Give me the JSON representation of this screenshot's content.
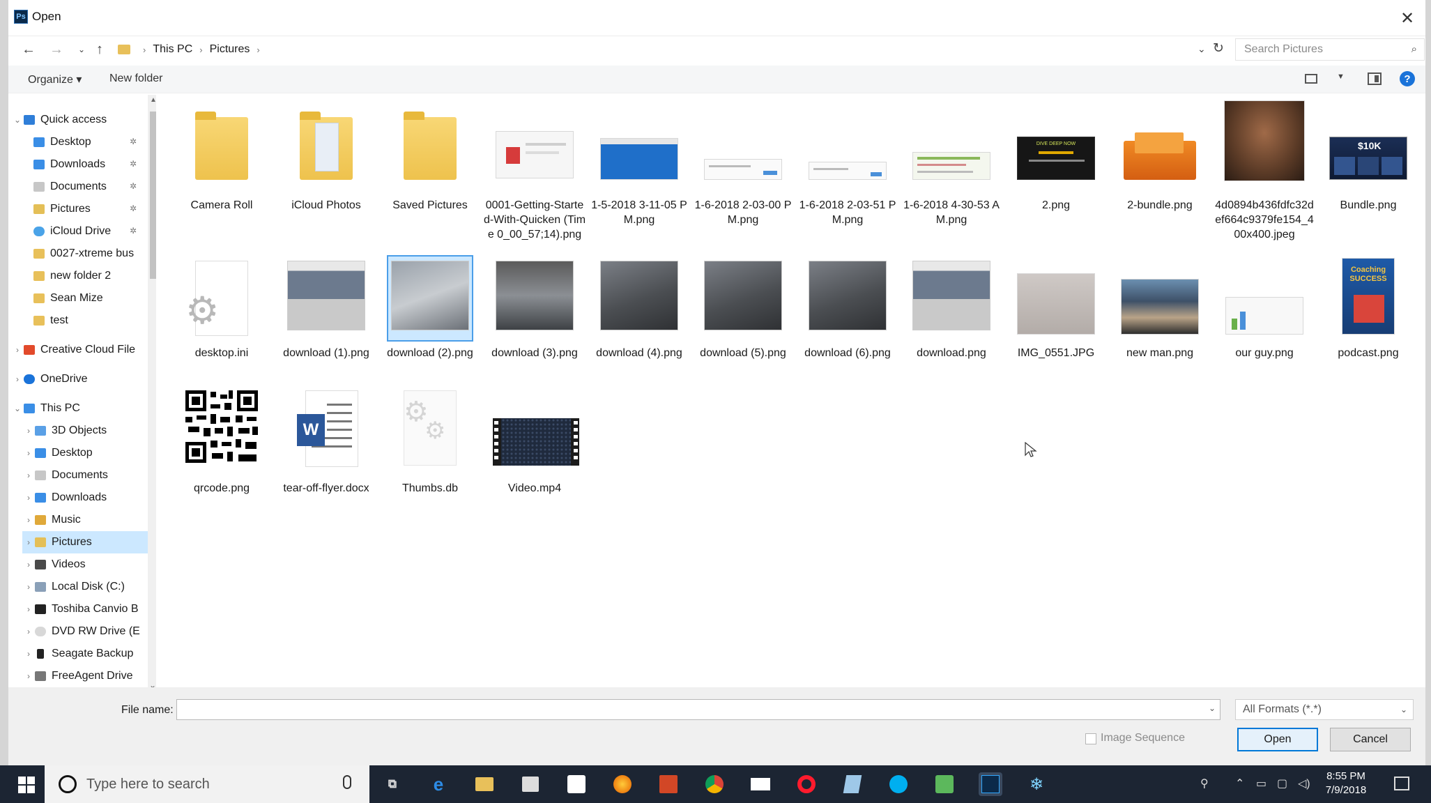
{
  "window": {
    "title": "Open",
    "app_icon_text": "Ps"
  },
  "address": {
    "crumbs": [
      "This PC",
      "Pictures"
    ],
    "search_placeholder": "Search Pictures"
  },
  "toolbar": {
    "organize": "Organize ▾",
    "new_folder": "New folder",
    "help": "?"
  },
  "nav": {
    "quick_access": "Quick access",
    "quick_items": [
      "Desktop",
      "Downloads",
      "Documents",
      "Pictures",
      "iCloud Drive",
      "0027-xtreme bus",
      "new folder 2",
      "Sean Mize",
      "test"
    ],
    "creative_cloud": "Creative Cloud File",
    "onedrive": "OneDrive",
    "this_pc": "This PC",
    "pc_items": [
      "3D Objects",
      "Desktop",
      "Documents",
      "Downloads",
      "Music",
      "Pictures",
      "Videos",
      "Local Disk (C:)",
      "Toshiba Canvio B",
      "DVD RW Drive (E",
      "Seagate Backup",
      "FreeAgent Drive"
    ],
    "selected": "Pictures"
  },
  "files": [
    "Camera Roll",
    "iCloud Photos",
    "Saved Pictures",
    "0001-Getting-Started-With-Quicken (Time 0_00_57;14).png",
    "1-5-2018 3-11-05 PM.png",
    "1-6-2018 2-03-00 PM.png",
    "1-6-2018 2-03-51 PM.png",
    "1-6-2018 4-30-53 AM.png",
    "2.png",
    "2-bundle.png",
    "4d0894b436fdfc32def664c9379fe154_400x400.jpeg",
    "Bundle.png",
    "desktop.ini",
    "download (1).png",
    "download (2).png",
    "download (3).png",
    "download (4).png",
    "download (5).png",
    "download (6).png",
    "download.png",
    "IMG_0551.JPG",
    "new man.png",
    "our guy.png",
    "podcast.png",
    "qrcode.png",
    "tear-off-flyer.docx",
    "Thumbs.db",
    "Video.mp4"
  ],
  "thumb_text": {
    "bundle_price": "$10K",
    "podcast_title": "Coaching SUCCESS",
    "word_letter": "W",
    "promo_headline": "DIVE DEEP NOW"
  },
  "dialog": {
    "file_name_label": "File name:",
    "file_name_value": "",
    "format": "All Formats (*.*)",
    "image_sequence": "Image Sequence",
    "open": "Open",
    "cancel": "Cancel"
  },
  "taskbar": {
    "search": "Type here to search",
    "time": "8:55 PM",
    "date": "7/9/2018"
  }
}
